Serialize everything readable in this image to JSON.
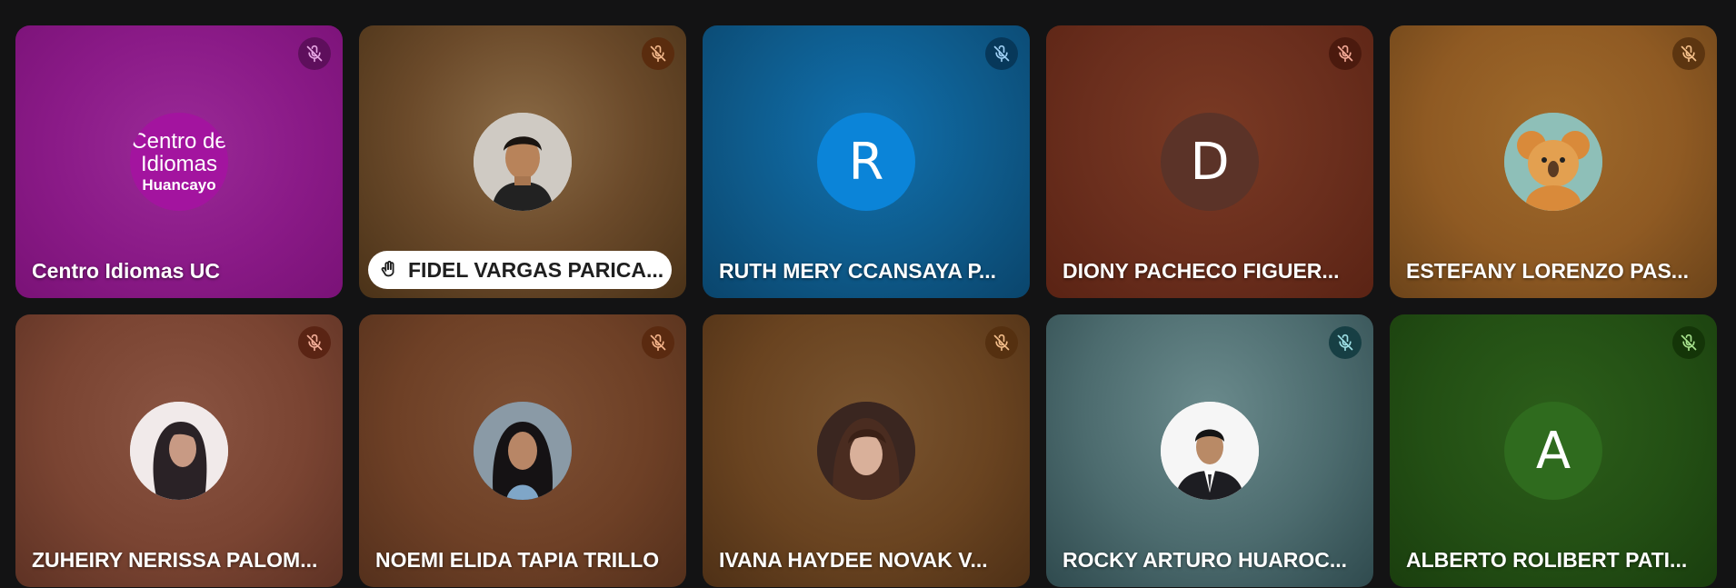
{
  "participants": [
    {
      "name": "Centro Idiomas UC",
      "avatar_type": "logo",
      "logo_line1": "Centro de",
      "logo_line2": "Idiomas",
      "logo_line3": "Huancayo",
      "bg": "#8a1a87",
      "mic_bg": "#5e0f5c",
      "mic_color": "#e7a7e4",
      "muted": true
    },
    {
      "name": "FIDEL VARGAS PARICA...",
      "avatar_type": "photo",
      "photo_icon": "man-photo",
      "bg": "#6b4a2a",
      "mic_bg": "#5a2c0e",
      "mic_color": "#f2b78a",
      "muted": true,
      "hand_raised": true
    },
    {
      "name": "RUTH MERY CCANSAYA P...",
      "avatar_type": "letter",
      "letter": "R",
      "avatar_color": "#0b84d8",
      "bg": "#0e5a8a",
      "mic_bg": "#07385a",
      "mic_color": "#9fd0f5",
      "muted": true
    },
    {
      "name": "DIONY PACHECO FIGUER...",
      "avatar_type": "letter",
      "letter": "D",
      "avatar_color": "#5b3328",
      "bg": "#6a2e1d",
      "mic_bg": "#4b1a0e",
      "mic_color": "#f3a996",
      "muted": true
    },
    {
      "name": "ESTEFANY LORENZO PAS...",
      "avatar_type": "photo",
      "photo_icon": "koala-illustration",
      "bg": "#8f5a23",
      "mic_bg": "#5c3510",
      "mic_color": "#f5c08a",
      "muted": true
    },
    {
      "name": "ZUHEIRY NERISSA PALOM...",
      "avatar_type": "photo",
      "photo_icon": "woman-photo",
      "bg": "#7a4432",
      "mic_bg": "#5a2414",
      "mic_color": "#f3ae98",
      "muted": true
    },
    {
      "name": "NOEMI ELIDA TAPIA TRILLO",
      "avatar_type": "photo",
      "photo_icon": "woman-photo",
      "bg": "#6e4026",
      "mic_bg": "#5a2a10",
      "mic_color": "#f5b48a",
      "muted": true
    },
    {
      "name": "IVANA HAYDEE NOVAK V...",
      "avatar_type": "photo",
      "photo_icon": "woman-photo",
      "bg": "#694320",
      "mic_bg": "#553010",
      "mic_color": "#f3bd8a",
      "muted": true
    },
    {
      "name": "ROCKY ARTURO HUAROC...",
      "avatar_type": "photo",
      "photo_icon": "man-suit-photo",
      "bg": "#4c6b6e",
      "mic_bg": "#173f44",
      "mic_color": "#9ee0e6",
      "muted": true
    },
    {
      "name": "ALBERTO ROLIBERT PATI...",
      "avatar_type": "letter",
      "letter": "A",
      "avatar_color": "#2f6b1e",
      "bg": "#234f14",
      "mic_bg": "#143508",
      "mic_color": "#a8e38e",
      "muted": true
    }
  ]
}
